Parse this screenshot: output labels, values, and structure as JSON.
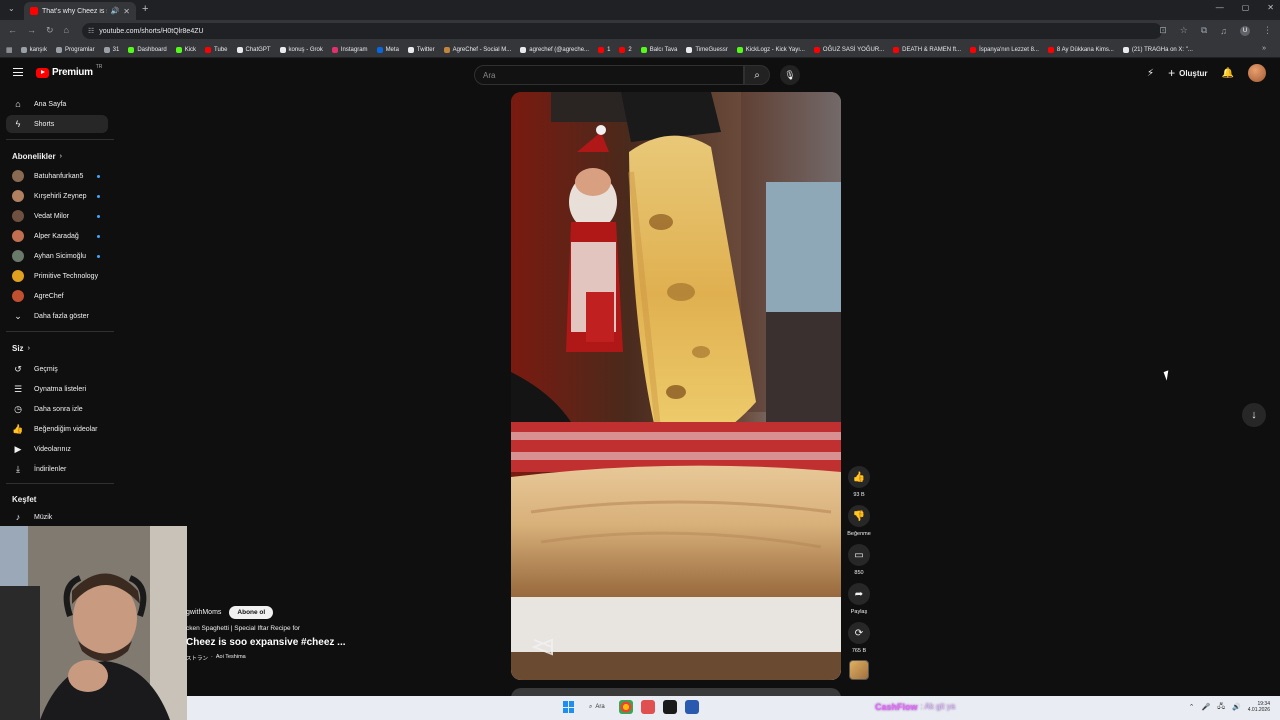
{
  "browser": {
    "tab_title": "That's why Cheez is soo exp",
    "url": "youtube.com/shorts/H0tQlr8e4ZU",
    "bookmarks": [
      {
        "label": "kanşık",
        "color": "#9aa0a6"
      },
      {
        "label": "Programlar",
        "color": "#9aa0a6"
      },
      {
        "label": "31",
        "color": "#9aa0a6"
      },
      {
        "label": "Dashboard",
        "color": "#53fc18"
      },
      {
        "label": "Kick",
        "color": "#53fc18"
      },
      {
        "label": "Tube",
        "color": "#ff0000"
      },
      {
        "label": "ChatGPT",
        "color": "#e8eaed"
      },
      {
        "label": "konuş - Grok",
        "color": "#e8eaed"
      },
      {
        "label": "Instagram",
        "color": "#e1306c"
      },
      {
        "label": "Meta",
        "color": "#0668e1"
      },
      {
        "label": "Twitter",
        "color": "#e8eaed"
      },
      {
        "label": "AgreChef - Social M...",
        "color": "#c0843a"
      },
      {
        "label": "agrechef (@agreche...",
        "color": "#e8eaed"
      },
      {
        "label": "1",
        "color": "#ff0000"
      },
      {
        "label": "2",
        "color": "#ff0000"
      },
      {
        "label": "Balcı Tava",
        "color": "#53fc18"
      },
      {
        "label": "TimeGuessr",
        "color": "#e8eaed"
      },
      {
        "label": "KickLogz - Kick Yayı...",
        "color": "#53fc18"
      },
      {
        "label": "OĞUZ SASİ YOĞUR...",
        "color": "#ff0000"
      },
      {
        "label": "DEATH & RAMEN ft...",
        "color": "#ff0000"
      },
      {
        "label": "İspanya'nın Lezzet 8...",
        "color": "#ff0000"
      },
      {
        "label": "8 Ay Dükkana Kims...",
        "color": "#ff0000"
      },
      {
        "label": "(21) TRAGHa on X: \"...",
        "color": "#e8eaed"
      }
    ]
  },
  "youtube": {
    "logo_text": "Premium",
    "logo_tr": "TR",
    "search_placeholder": "Ara",
    "create_label": "Oluştur"
  },
  "sidebar": {
    "main": [
      {
        "label": "Ana Sayfa",
        "icon": "home-icon",
        "glyph": "⌂"
      },
      {
        "label": "Shorts",
        "icon": "shorts-icon",
        "glyph": "ϟ"
      }
    ],
    "subscriptions_title": "Abonelikler",
    "subscriptions": [
      {
        "label": "Batuhanfurkan5",
        "color": "#8a6a50"
      },
      {
        "label": "Kırşehirli Zeynep",
        "color": "#b08060"
      },
      {
        "label": "Vedat Milor",
        "color": "#705040"
      },
      {
        "label": "Alper Karadağ",
        "color": "#c07050"
      },
      {
        "label": "Ayhan Sicimoğlu",
        "color": "#6a7a6a"
      },
      {
        "label": "Primitive Technology",
        "color": "#e0a020"
      },
      {
        "label": "AgreChef",
        "color": "#c05030"
      }
    ],
    "show_more": "Daha fazla göster",
    "you_title": "Siz",
    "you": [
      {
        "label": "Geçmiş",
        "icon": "history-icon",
        "glyph": "↺"
      },
      {
        "label": "Oynatma listeleri",
        "icon": "playlist-icon",
        "glyph": "☰"
      },
      {
        "label": "Daha sonra izle",
        "icon": "watch-later-icon",
        "glyph": "◷"
      },
      {
        "label": "Beğendiğim videolar",
        "icon": "like-icon",
        "glyph": "👍"
      },
      {
        "label": "Videolarınız",
        "icon": "your-videos-icon",
        "glyph": "▶"
      },
      {
        "label": "İndirilenler",
        "icon": "download-icon",
        "glyph": "⤓"
      }
    ],
    "explore_title": "Keşfet",
    "explore": [
      {
        "label": "Müzik",
        "icon": "music-icon",
        "glyph": "♪"
      }
    ]
  },
  "short": {
    "channel": "gwithMoms",
    "subscribe_label": "Abone ol",
    "description": "cken Spaghetti | Special Iftar Recipe for",
    "title": "Cheez is soo expansive #cheez ...",
    "music_prefix": "ストラン",
    "music_artist": "Aoi Teshima"
  },
  "actions": {
    "like_count": "93 B",
    "dislike_label": "Beğenme",
    "comment_count": "850",
    "share_label": "Paylaş",
    "remix_count": "765 B"
  },
  "taskbar": {
    "search_label": "Ara",
    "cashflow_title": "CashFlow",
    "cashflow_sub": ": Ak git ya",
    "time": "19:34",
    "date": "4.01.2026"
  }
}
